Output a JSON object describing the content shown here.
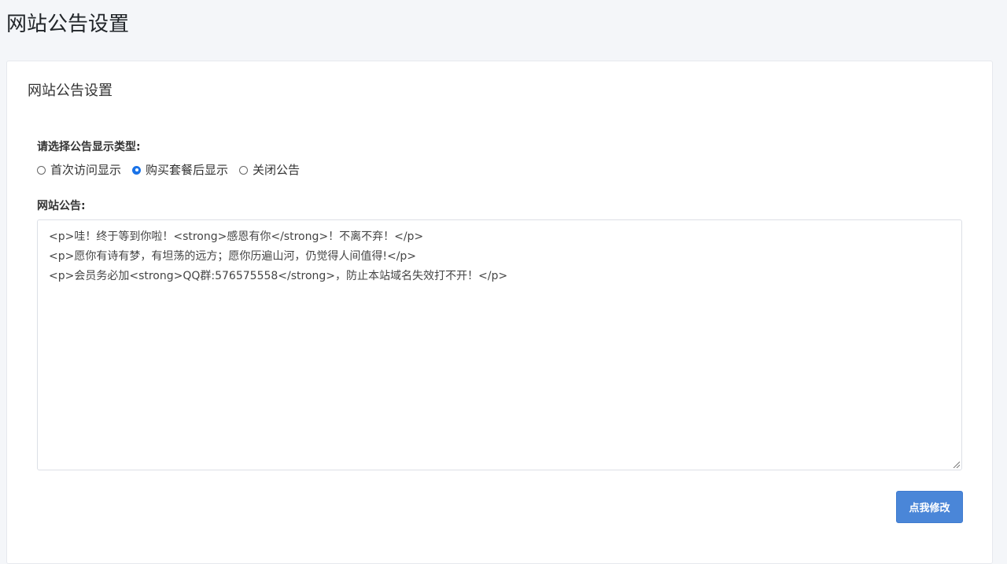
{
  "page": {
    "title": "网站公告设置"
  },
  "card": {
    "title": "网站公告设置"
  },
  "display_type": {
    "label": "请选择公告显示类型:",
    "options": [
      {
        "label": "首次访问显示",
        "checked": false
      },
      {
        "label": "购买套餐后显示",
        "checked": true
      },
      {
        "label": "关闭公告",
        "checked": false
      }
    ]
  },
  "notice": {
    "label": "网站公告:",
    "value": "<p>哇！终于等到你啦！<strong>感恩有你</strong>！不离不弃！</p>\n<p>愿你有诗有梦，有坦荡的远方；愿你历遍山河，仍觉得人间值得!</p>\n<p>会员务必加<strong>QQ群:576575558</strong>，防止本站域名失效打不开！</p>"
  },
  "actions": {
    "submit_label": "点我修改"
  },
  "colors": {
    "accent": "#4a86d8",
    "radio_checked": "#1a73e8",
    "background": "#f4f6f9"
  }
}
